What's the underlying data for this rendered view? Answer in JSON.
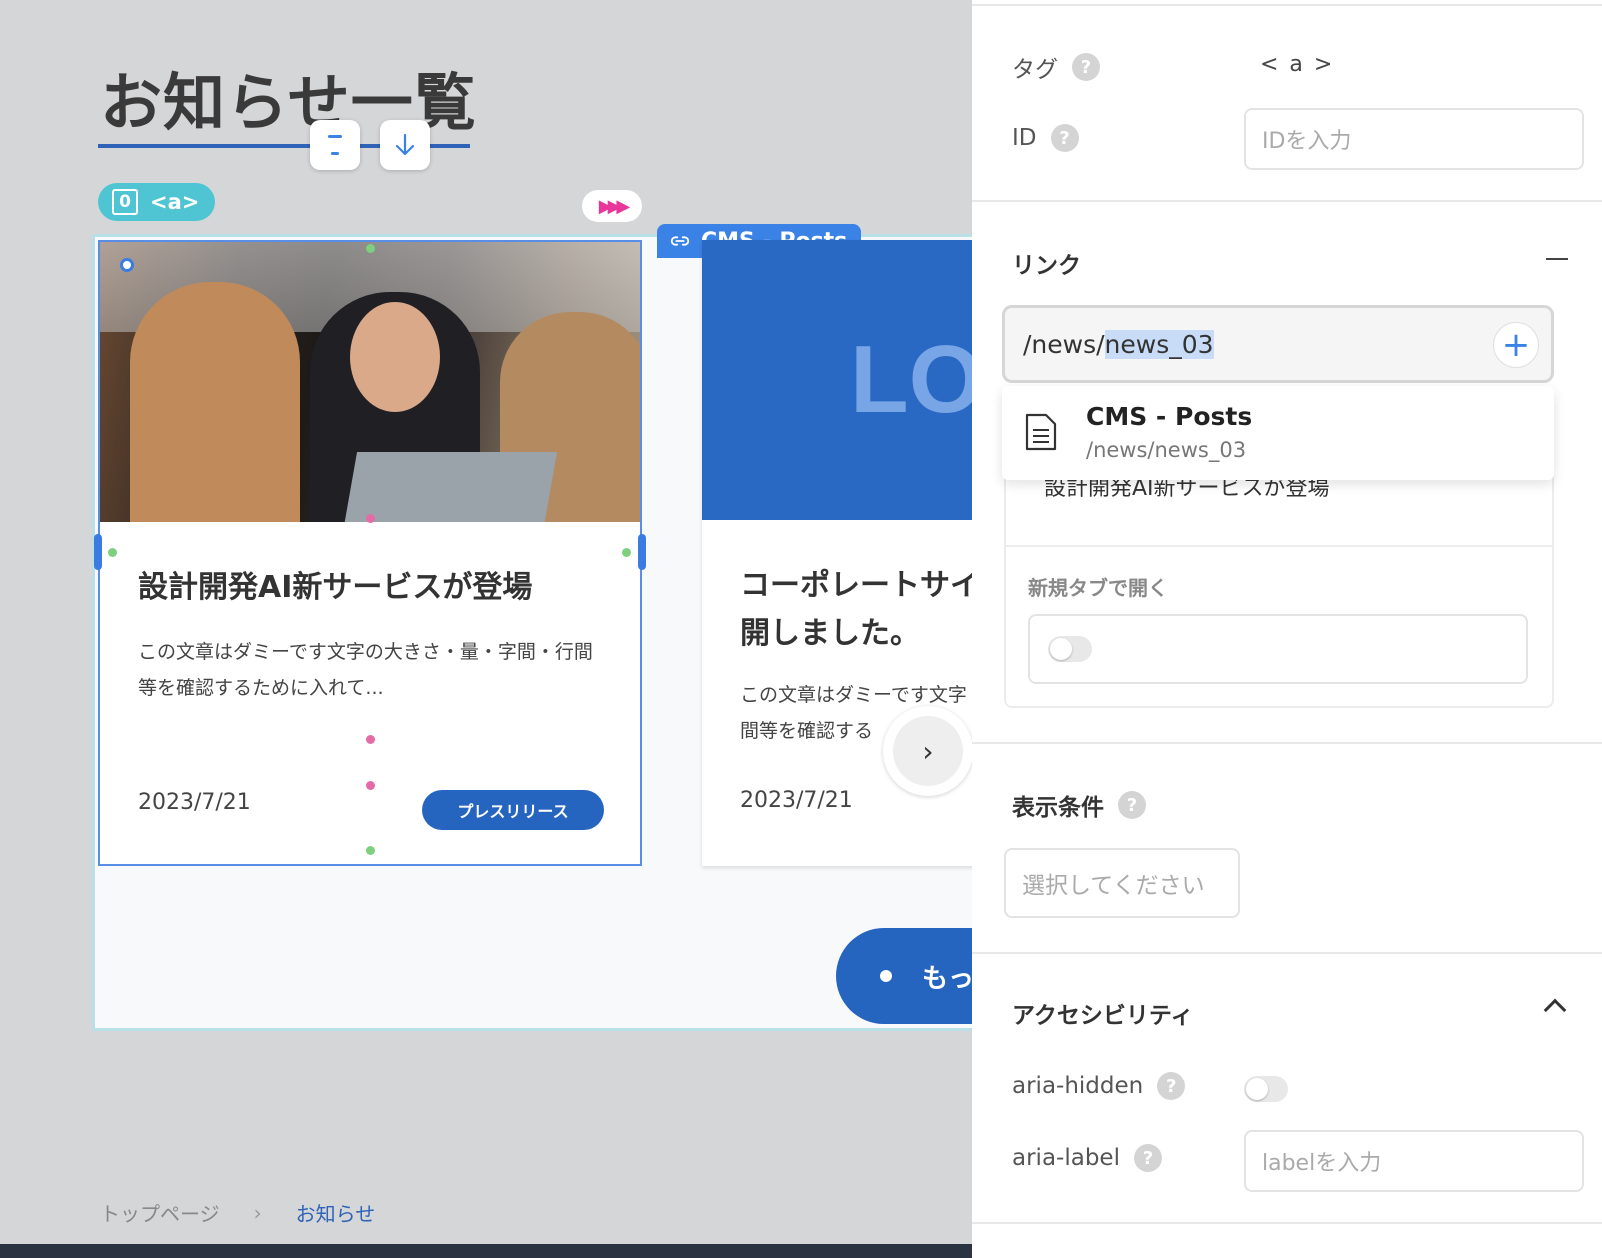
{
  "canvas": {
    "page_title": "お知らせ一覧",
    "tag_badge": {
      "index": "0",
      "tag": "<a>"
    },
    "cms_badge": "CMS - Posts",
    "cards": [
      {
        "title": "設計開発AI新サービスが登場",
        "desc": "この文章はダミーです文字の大きさ・量・字間・行間等を確認するために入れて...",
        "date": "2023/7/21",
        "tag": "プレスリリース"
      },
      {
        "logo": "LO",
        "title": "コーポレートサイル公開しました。",
        "desc": "この文章はダミーです文字間等を確認する",
        "date": "2023/7/21"
      }
    ],
    "more_button": "もっ",
    "breadcrumb": {
      "home": "トップページ",
      "current": "お知らせ"
    }
  },
  "panel": {
    "tag_label": "タグ",
    "tag_value": "< a >",
    "id_label": "ID",
    "id_placeholder": "IDを入力",
    "link_label": "リンク",
    "link_prefix": "/news/",
    "link_selected": "news_03",
    "suggestion": {
      "title": "CMS - Posts",
      "path": "/news/news_03"
    },
    "behind_text": "設計開発AI新サービスが登場",
    "newtab_label": "新規タブで開く",
    "condition_label": "表示条件",
    "condition_placeholder": "選択してください",
    "accessibility_label": "アクセシビリティ",
    "aria_hidden_label": "aria-hidden",
    "aria_label_label": "aria-label",
    "aria_label_placeholder": "labelを入力"
  },
  "colors": {
    "accent": "#3b82e6",
    "brand_blue": "#2565c0",
    "badge_teal": "#4fc4d3"
  }
}
